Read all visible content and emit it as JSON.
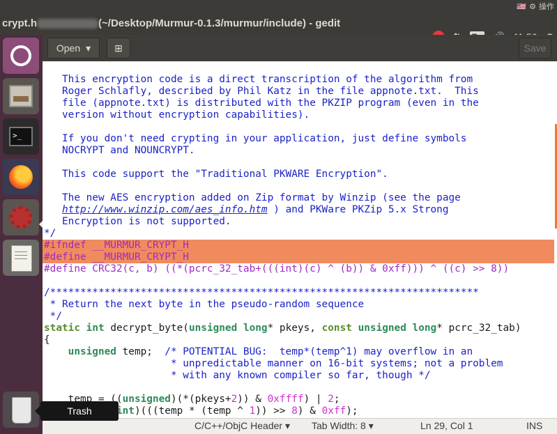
{
  "top_panel": {
    "tray_items": [
      "🇺🇸",
      "⚙",
      "操作"
    ],
    "window_title_prefix": "crypt.h",
    "window_title_suffix": "(~/Desktop/Murmur-0.1.3/murmur/include) - gedit",
    "keyboard_layout": "En",
    "volume_glyph": "🔊",
    "network_glyph": "⇅",
    "clock": "11:56",
    "settings_glyph": "⚙"
  },
  "launcher": {
    "terminal_prompt": ">_",
    "tooltip": "Trash"
  },
  "toolbar": {
    "open_label": "Open",
    "open_arrow": "▾",
    "new_tab_glyph": "⊞",
    "save_label": "Save"
  },
  "editor": {
    "lines": [
      "   This encryption code is a direct transcription of the algorithm from",
      "   Roger Schlafly, described by Phil Katz in the file appnote.txt.  This",
      "   file (appnote.txt) is distributed with the PKZIP program (even in the",
      "   version without encryption capabilities).",
      "",
      "   If you don't need crypting in your application, just define symbols",
      "   NOCRYPT and NOUNCRYPT.",
      "",
      "   This code support the \"Traditional PKWARE Encryption\".",
      "",
      "   The new AES encryption added on Zip format by Winzip (see the page",
      "   http://www.winzip.com/aes_info.htm ) and PKWare PKZip 5.x Strong",
      "   Encryption is not supported.",
      "*/",
      "#ifndef __MURMUR_CRYPT_H",
      "#define __MURMUR_CRYPT_H",
      "#define CRC32(c, b) ((*(pcrc_32_tab+(((int)(c) ^ (b)) & 0xff))) ^ ((c) >> 8))",
      "",
      "/***********************************************************************",
      " * Return the next byte in the pseudo-random sequence",
      " */",
      "static int decrypt_byte(unsigned long* pkeys, const unsigned long* pcrc_32_tab)",
      "{",
      "    unsigned temp;  /* POTENTIAL BUG:  temp*(temp^1) may overflow in an",
      "                     * unpredictable manner on 16-bit systems; not a problem",
      "                     * with any known compiler so far, though */",
      "",
      "    temp = ((unsigned)(*(pkeys+2)) & 0xffff) | 2;",
      "    return (int)(((temp * (temp ^ 1)) >> 8) & 0xff);"
    ]
  },
  "statusbar": {
    "language": "C/C++/ObjC Header",
    "tab_width": "Tab Width: 8",
    "position": "Ln 29, Col 1",
    "mode": "INS",
    "arrow": "▾"
  }
}
